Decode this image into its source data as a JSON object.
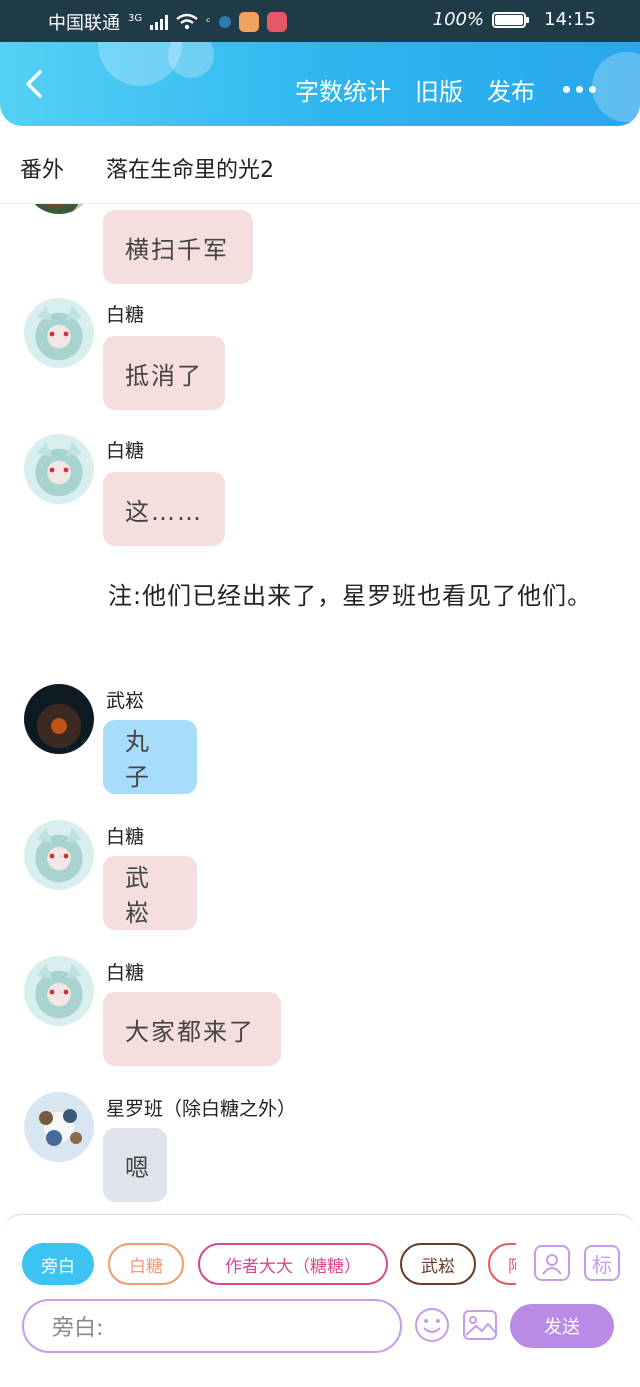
{
  "status_bar": {
    "carrier": "中国联通",
    "network": "3G",
    "battery": "100%",
    "battery_level": 1.0,
    "time": "14:15"
  },
  "app_bar": {
    "word_count": "字数统计",
    "old_version": "旧版",
    "publish": "发布"
  },
  "chapter": {
    "volume": "番外",
    "title": "落在生命里的光2"
  },
  "messages": [
    {
      "speaker": "",
      "text": "横扫千军",
      "bubble_color": "#f4dede"
    },
    {
      "speaker": "白糖",
      "text": "抵消了",
      "bubble_color": "#f4dede"
    },
    {
      "speaker": "白糖",
      "text": "这……",
      "bubble_color": "#f4dede"
    },
    {
      "speaker": "武崧",
      "text": "丸子",
      "bubble_color": "#a8dcfb"
    },
    {
      "speaker": "白糖",
      "text": "武崧",
      "bubble_color": "#f4dede"
    },
    {
      "speaker": "白糖",
      "text": "大家都来了",
      "bubble_color": "#f4dede"
    },
    {
      "speaker": "星罗班（除白糖之外）",
      "text": "嗯",
      "bubble_color": "#dfe4ea"
    }
  ],
  "narration_note": "注:他们已经出来了，星罗班也看见了他们。",
  "composer": {
    "chips": [
      {
        "label": "旁白",
        "color": "#3cc3f2"
      },
      {
        "label": "白糖",
        "color": "#f29a6e"
      },
      {
        "label": "作者大大（糖糖）",
        "color": "#d84a8c"
      },
      {
        "label": "武崧",
        "color": "#6b3a24"
      },
      {
        "label": "阿",
        "color": "#e05a5a"
      }
    ],
    "role_icon": "person-card-icon",
    "tag_label": "标",
    "input_placeholder": "旁白:",
    "send_label": "发送",
    "accent_color": "#b98ae6"
  }
}
